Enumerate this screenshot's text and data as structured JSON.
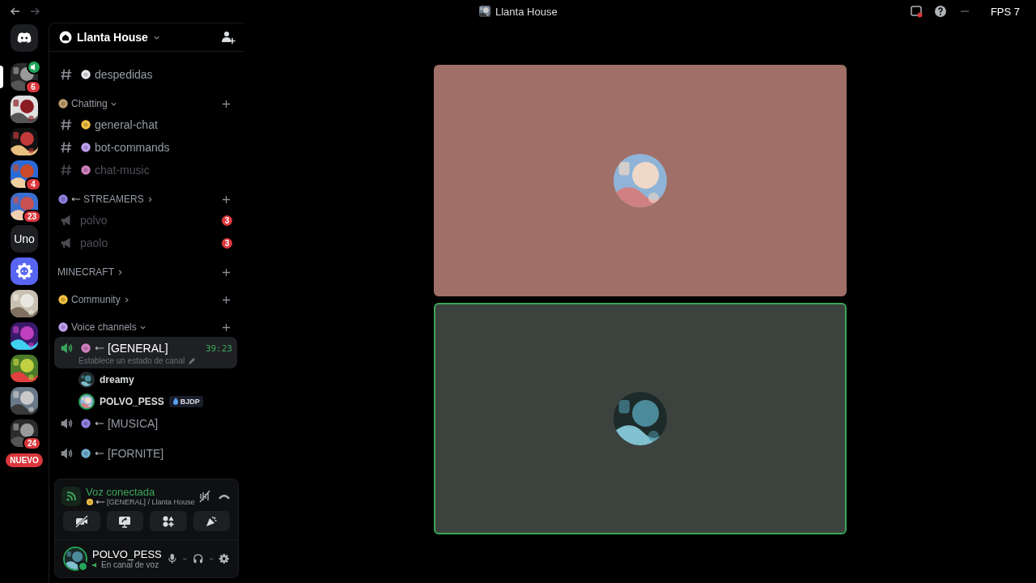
{
  "titlebar": {
    "title": "Llanta House",
    "fps": "FPS 7"
  },
  "servers": [
    {
      "kind": "home",
      "selected": false
    },
    {
      "kind": "picture",
      "selected": true,
      "badge": "6",
      "voice": true
    },
    {
      "kind": "picture",
      "selected": false
    },
    {
      "kind": "picture",
      "selected": false
    },
    {
      "kind": "picture",
      "selected": false,
      "badge": "4"
    },
    {
      "kind": "picture",
      "selected": false,
      "badge": "23"
    },
    {
      "kind": "text",
      "label": "Uno",
      "selected": false
    },
    {
      "kind": "bot",
      "selected": false
    },
    {
      "kind": "picture",
      "selected": false
    },
    {
      "kind": "picture",
      "selected": false
    },
    {
      "kind": "picture",
      "selected": false
    },
    {
      "kind": "picture",
      "selected": false
    },
    {
      "kind": "picture",
      "selected": false,
      "badge": "24"
    },
    {
      "kind": "new",
      "label": "NUEVO",
      "selected": false
    }
  ],
  "server_header": {
    "name": "Llanta House"
  },
  "channels": [
    {
      "kind": "text",
      "name": "despedidas",
      "muted": false
    },
    {
      "kind": "category",
      "name": "Chatting",
      "expanded": true,
      "emoji": true
    },
    {
      "kind": "text",
      "name": "general-chat",
      "muted": false
    },
    {
      "kind": "text",
      "name": "bot-commands",
      "muted": false
    },
    {
      "kind": "text",
      "name": "chat-music",
      "muted": true
    },
    {
      "kind": "category",
      "name": "STREAMERS",
      "expanded": false,
      "emoji": true
    },
    {
      "kind": "announce",
      "name": "polvo",
      "muted": true,
      "mentions": "3"
    },
    {
      "kind": "announce",
      "name": "paolo",
      "muted": true,
      "mentions": "3"
    },
    {
      "kind": "category",
      "name": "MINECRAFT",
      "expanded": false,
      "emoji": false
    },
    {
      "kind": "category",
      "name": "Community",
      "expanded": false,
      "emoji": true
    },
    {
      "kind": "category",
      "name": "Voice channels",
      "expanded": true,
      "emoji": true
    },
    {
      "kind": "voice",
      "name": "[GENERAL]",
      "selected": true,
      "timer": "39:23",
      "status": "Establece un estado de canal",
      "users": [
        {
          "name": "dreamy",
          "speaking": false
        },
        {
          "name": "POLVO_PESS",
          "speaking": true,
          "tag": "BJDP"
        }
      ]
    },
    {
      "kind": "voice",
      "name": "[MUSICA]",
      "selected": false
    },
    {
      "kind": "voice",
      "name": "[FORNITE]",
      "selected": false
    }
  ],
  "voice_panel": {
    "status": "Voz conectada",
    "location": "[GENERAL] / Llanta House"
  },
  "user_panel": {
    "name": "POLVO_PESS",
    "status": "En canal de voz",
    "online": true
  },
  "stage": [
    {
      "color": "#a07068",
      "speaking": false
    },
    {
      "color": "#3c423d",
      "speaking": true
    }
  ]
}
